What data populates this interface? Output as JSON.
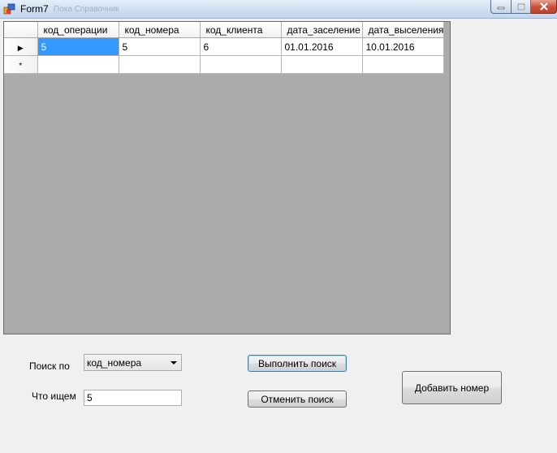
{
  "window": {
    "title": "Form7",
    "ghost_title": "Пока   Справочник",
    "min_glyph": "─",
    "max_glyph": "□",
    "close_glyph": "✕"
  },
  "grid": {
    "columns": [
      "код_операции",
      "код_номера",
      "код_клиента",
      "дата_заселение",
      "дата_выселения"
    ],
    "rows": [
      [
        "5",
        "5",
        "6",
        "01.01.2016",
        "10.01.2016"
      ]
    ],
    "current_row_glyph": "▶",
    "new_row_glyph": "*"
  },
  "search": {
    "search_by_label": "Поиск по",
    "search_by_value": "код_номера",
    "query_label": "Что ищем",
    "query_value": "5"
  },
  "buttons": {
    "execute": "Выполнить поиск",
    "cancel": "Отменить поиск",
    "add_room": "Добавить номер"
  },
  "colors": {
    "selection": "#3399ff",
    "grid_background": "#ababab",
    "form_background": "#f0f0f0"
  }
}
